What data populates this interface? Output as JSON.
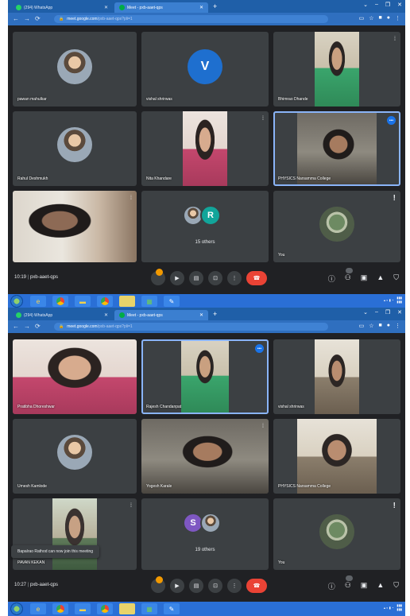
{
  "screenshots": [
    {
      "tabs": [
        {
          "label": "(294) WhatsApp",
          "active": false
        },
        {
          "label": "Meet - pxb-aaet-qps",
          "active": true
        }
      ],
      "url": {
        "host": "meet.google.com",
        "path": "/pxb-aaet-qps?pli=1"
      },
      "tiles": [
        {
          "name": "pawan mahulkar"
        },
        {
          "name": "vishal shrirwas",
          "initial": "V"
        },
        {
          "name": "Bhimrao Dhande"
        },
        {
          "name": "Rahul Deshmukh"
        },
        {
          "name": "Nita Khandare"
        },
        {
          "name": "PHYSICS Narsamma College"
        },
        {
          "name": ""
        },
        {
          "others_count": "15 others",
          "initial": "R"
        },
        {
          "name": "You"
        }
      ],
      "meeting_time": "10:19",
      "meeting_code": "pxb-aaet-qps",
      "toast": ""
    },
    {
      "tabs": [
        {
          "label": "(294) WhatsApp",
          "active": false
        },
        {
          "label": "Meet - pxb-aaet-qps",
          "active": true
        }
      ],
      "url": {
        "host": "meet.google.com",
        "path": "/pxb-aaet-qps?pli=1"
      },
      "tiles": [
        {
          "name": "Pratibha Dhoreshwar"
        },
        {
          "name": "Rajesh Chandanpat"
        },
        {
          "name": "vishal shrirwas"
        },
        {
          "name": "Umesh Kamlode"
        },
        {
          "name": "Yogesh Karale"
        },
        {
          "name": "PHYSICS Narsamma College"
        },
        {
          "name": "PAVAN KEKAN"
        },
        {
          "others_count": "19 others",
          "initial": "S"
        },
        {
          "name": "You"
        }
      ],
      "meeting_time": "10:27",
      "meeting_code": "pxb-aaet-qps",
      "toast": "Bapalrao Rathod can now join this meeting"
    }
  ],
  "colors": {
    "meet_bg": "#202124",
    "tile_bg": "#3c4043",
    "leave_red": "#ea4335",
    "speaking_outline": "#8ab4f8",
    "avatar_blue": "#1e6fcf",
    "avatar_teal": "#12a59a",
    "avatar_purple": "#7e57c2",
    "taskbar_blue": "#2a6fd6"
  },
  "icons": {
    "mic": "microphone-icon",
    "camera": "camera-icon",
    "captions": "captions-icon",
    "present": "present-icon",
    "more": "more-vert-icon",
    "leave": "call-end-icon",
    "info": "info-icon",
    "people": "people-icon",
    "chat": "chat-icon",
    "activities": "activities-icon",
    "host": "shield-icon"
  }
}
